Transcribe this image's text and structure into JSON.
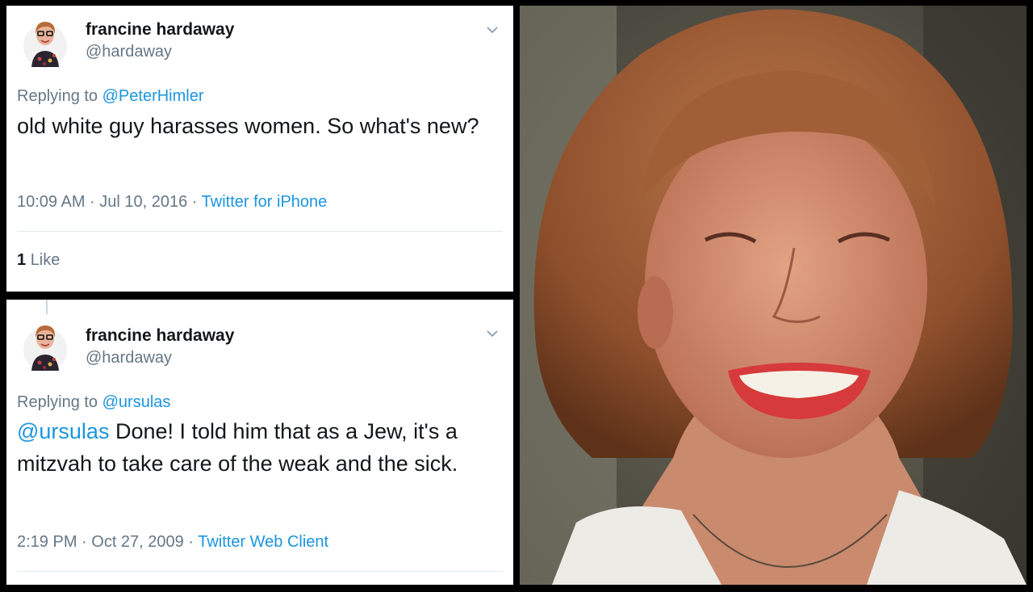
{
  "tweets": [
    {
      "author_name": "francine hardaway",
      "handle": "@hardaway",
      "replying_prefix": "Replying to",
      "replying_to": "@PeterHimler",
      "text": "old white guy harasses women. So what's new?",
      "time": "10:09 AM · Jul 10, 2016 ·",
      "source": "Twitter for iPhone",
      "likes_count": "1",
      "likes_label": "Like"
    },
    {
      "author_name": "francine hardaway",
      "handle": "@hardaway",
      "replying_prefix": "Replying to",
      "replying_to": "@ursulas",
      "text_mention": "@ursulas",
      "text": "Done! I told him that as a Jew, it's a mitzvah to take care of the weak and the sick.",
      "time": "2:19 PM · Oct 27, 2009 ·",
      "source": "Twitter Web Client"
    }
  ],
  "colors": {
    "link": "#1b95e0",
    "secondary_text": "#657786",
    "primary_text": "#14171a",
    "divider": "#e1e8ed"
  },
  "icons": [
    "chevron-down-icon"
  ]
}
